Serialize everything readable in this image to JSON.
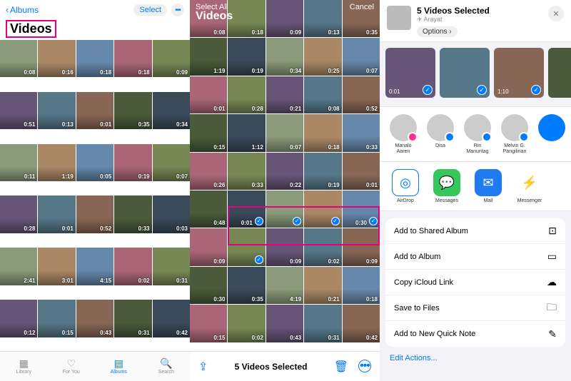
{
  "panel1": {
    "back": "Albums",
    "select": "Select",
    "title": "Videos",
    "tabs": [
      {
        "label": "Library"
      },
      {
        "label": "For You"
      },
      {
        "label": "Albums"
      },
      {
        "label": "Search"
      }
    ],
    "durations": [
      "0:08",
      "0:16",
      "0:18",
      "0:18",
      "0:09",
      "0:51",
      "0:13",
      "0:01",
      "0:35",
      "0:34",
      "0:11",
      "1:19",
      "0:05",
      "0:19",
      "0:07",
      "0:28",
      "0:01",
      "0:52",
      "0:33",
      "0:03",
      "2:41",
      "3:01",
      "4:15",
      "0:02",
      "0:31",
      "0:12",
      "0:15",
      "0:43",
      "0:31",
      "0:42"
    ]
  },
  "panel2": {
    "selectAll": "Select All",
    "cancel": "Cancel",
    "title": "Videos",
    "count": "5 Videos Selected",
    "cells": [
      {
        "d": "0:08"
      },
      {
        "d": "0:18"
      },
      {
        "d": "0:09"
      },
      {
        "d": "0:13"
      },
      {
        "d": "0:35"
      },
      {
        "d": "1:19"
      },
      {
        "d": "0:19"
      },
      {
        "d": "0:34"
      },
      {
        "d": "0:25"
      },
      {
        "d": "0:07"
      },
      {
        "d": "0:01"
      },
      {
        "d": "0:28"
      },
      {
        "d": "0:21"
      },
      {
        "d": "0:08"
      },
      {
        "d": "0:52"
      },
      {
        "d": "0:15"
      },
      {
        "d": "1:12"
      },
      {
        "d": "0:07"
      },
      {
        "d": "0:18"
      },
      {
        "d": "0:33"
      },
      {
        "d": "0:26"
      },
      {
        "d": "0:33"
      },
      {
        "d": "0:22"
      },
      {
        "d": "0:19"
      },
      {
        "d": "0:01"
      },
      {
        "d": "0:48"
      },
      {
        "d": "0:01",
        "s": true
      },
      {
        "d": "",
        "s": true
      },
      {
        "d": "",
        "s": true
      },
      {
        "d": "0:30",
        "s": true
      },
      {
        "d": "0:09"
      },
      {
        "d": "",
        "s": true
      },
      {
        "d": "0:09"
      },
      {
        "d": "0:02"
      },
      {
        "d": "0:09"
      },
      {
        "d": "0:30"
      },
      {
        "d": "0:35"
      },
      {
        "d": "4:19"
      },
      {
        "d": "0:21"
      },
      {
        "d": "0:18"
      },
      {
        "d": "0:15"
      },
      {
        "d": "0:02"
      },
      {
        "d": "0:43"
      },
      {
        "d": "0:31"
      },
      {
        "d": "0:42"
      }
    ]
  },
  "panel3": {
    "title": "5 Videos Selected",
    "location": "Arayat",
    "options": "Options",
    "strip": [
      {
        "d": "0:01"
      },
      {
        "d": ""
      },
      {
        "d": "1:10"
      },
      {
        "d": ""
      }
    ],
    "contacts": [
      {
        "name": "Manalo Aaren",
        "badge": "#ff2d92"
      },
      {
        "name": "Disa",
        "badge": "#007aff"
      },
      {
        "name": "Rin Manuntag",
        "badge": "#007aff"
      },
      {
        "name": "Melvin G. Pangilinan",
        "badge": "#007aff"
      }
    ],
    "apps": [
      {
        "name": "AirDrop",
        "bg": "#fff",
        "border": "#007aff",
        "glyph": "◎",
        "color": "#007aff"
      },
      {
        "name": "Messages",
        "bg": "#34c759",
        "glyph": "💬"
      },
      {
        "name": "Mail",
        "bg": "#1e7cf0",
        "glyph": "✉"
      },
      {
        "name": "Messenger",
        "bg": "#fff",
        "glyph": "⚡",
        "color": "#a033ff"
      }
    ],
    "actions": [
      {
        "label": "Add to Shared Album",
        "icon": "shared-album-icon",
        "glyph": "⊡"
      },
      {
        "label": "Add to Album",
        "icon": "album-icon",
        "glyph": "▭"
      },
      {
        "label": "Copy iCloud Link",
        "icon": "cloud-icon",
        "glyph": "☁"
      },
      {
        "label": "Save to Files",
        "icon": "folder-icon",
        "glyph": "🗀"
      },
      {
        "label": "Add to New Quick Note",
        "icon": "note-icon",
        "glyph": "✎"
      }
    ],
    "edit": "Edit Actions..."
  }
}
